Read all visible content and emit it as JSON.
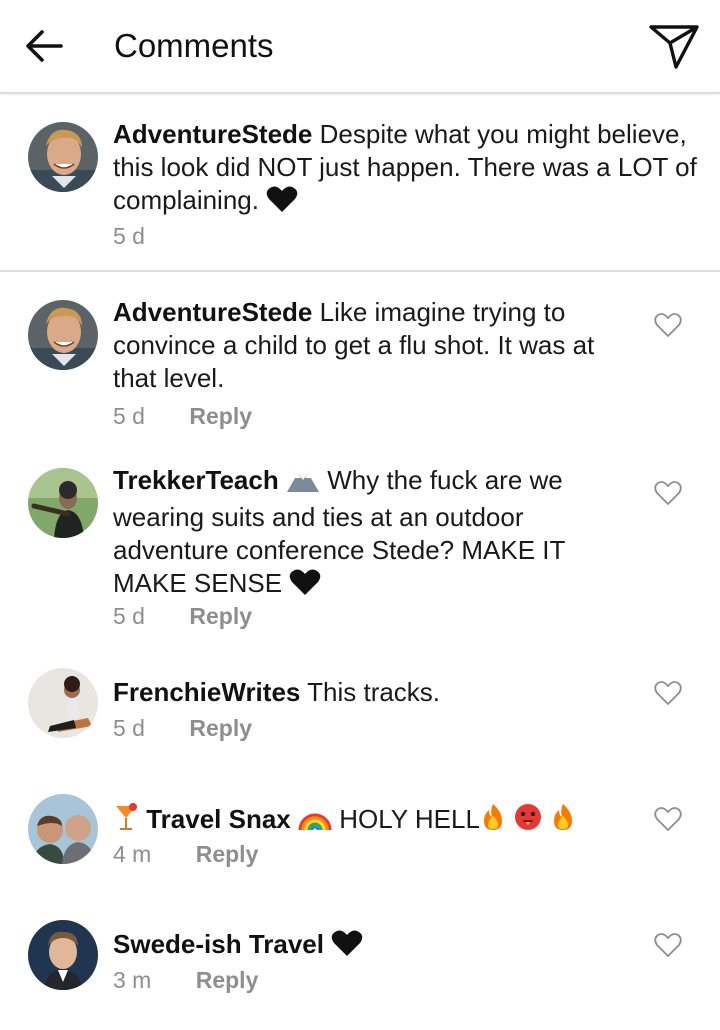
{
  "header": {
    "title": "Comments",
    "back_icon": "back-arrow-icon",
    "send_icon": "paper-plane-icon"
  },
  "caption": {
    "username": "AdventureStede",
    "text_before": "Despite what you might believe, this look did NOT just happen. There was a LOT of complaining.",
    "time": "5 d"
  },
  "comments": [
    {
      "username": "AdventureStede",
      "text": "Like imagine trying to convince a child to get a flu shot. It was at that level.",
      "time": "5 d",
      "reply": "Reply"
    },
    {
      "username": "TrekkerTeach",
      "text": "Why the fuck are we wearing suits and ties at an outdoor adventure conference Stede? MAKE IT MAKE SENSE",
      "time": "5 d",
      "reply": "Reply"
    },
    {
      "username": "FrenchieWrites",
      "text": "This tracks.",
      "time": "5 d",
      "reply": "Reply"
    },
    {
      "username": "Travel Snax",
      "text": "HOLY HELL",
      "time": "4 m",
      "reply": "Reply"
    },
    {
      "username": "Swede-ish Travel",
      "text": "",
      "time": "3 m",
      "reply": "Reply"
    }
  ],
  "colors": {
    "accent_text": "#111111",
    "muted": "#8e8e8e",
    "divider": "#dcdcdc"
  }
}
